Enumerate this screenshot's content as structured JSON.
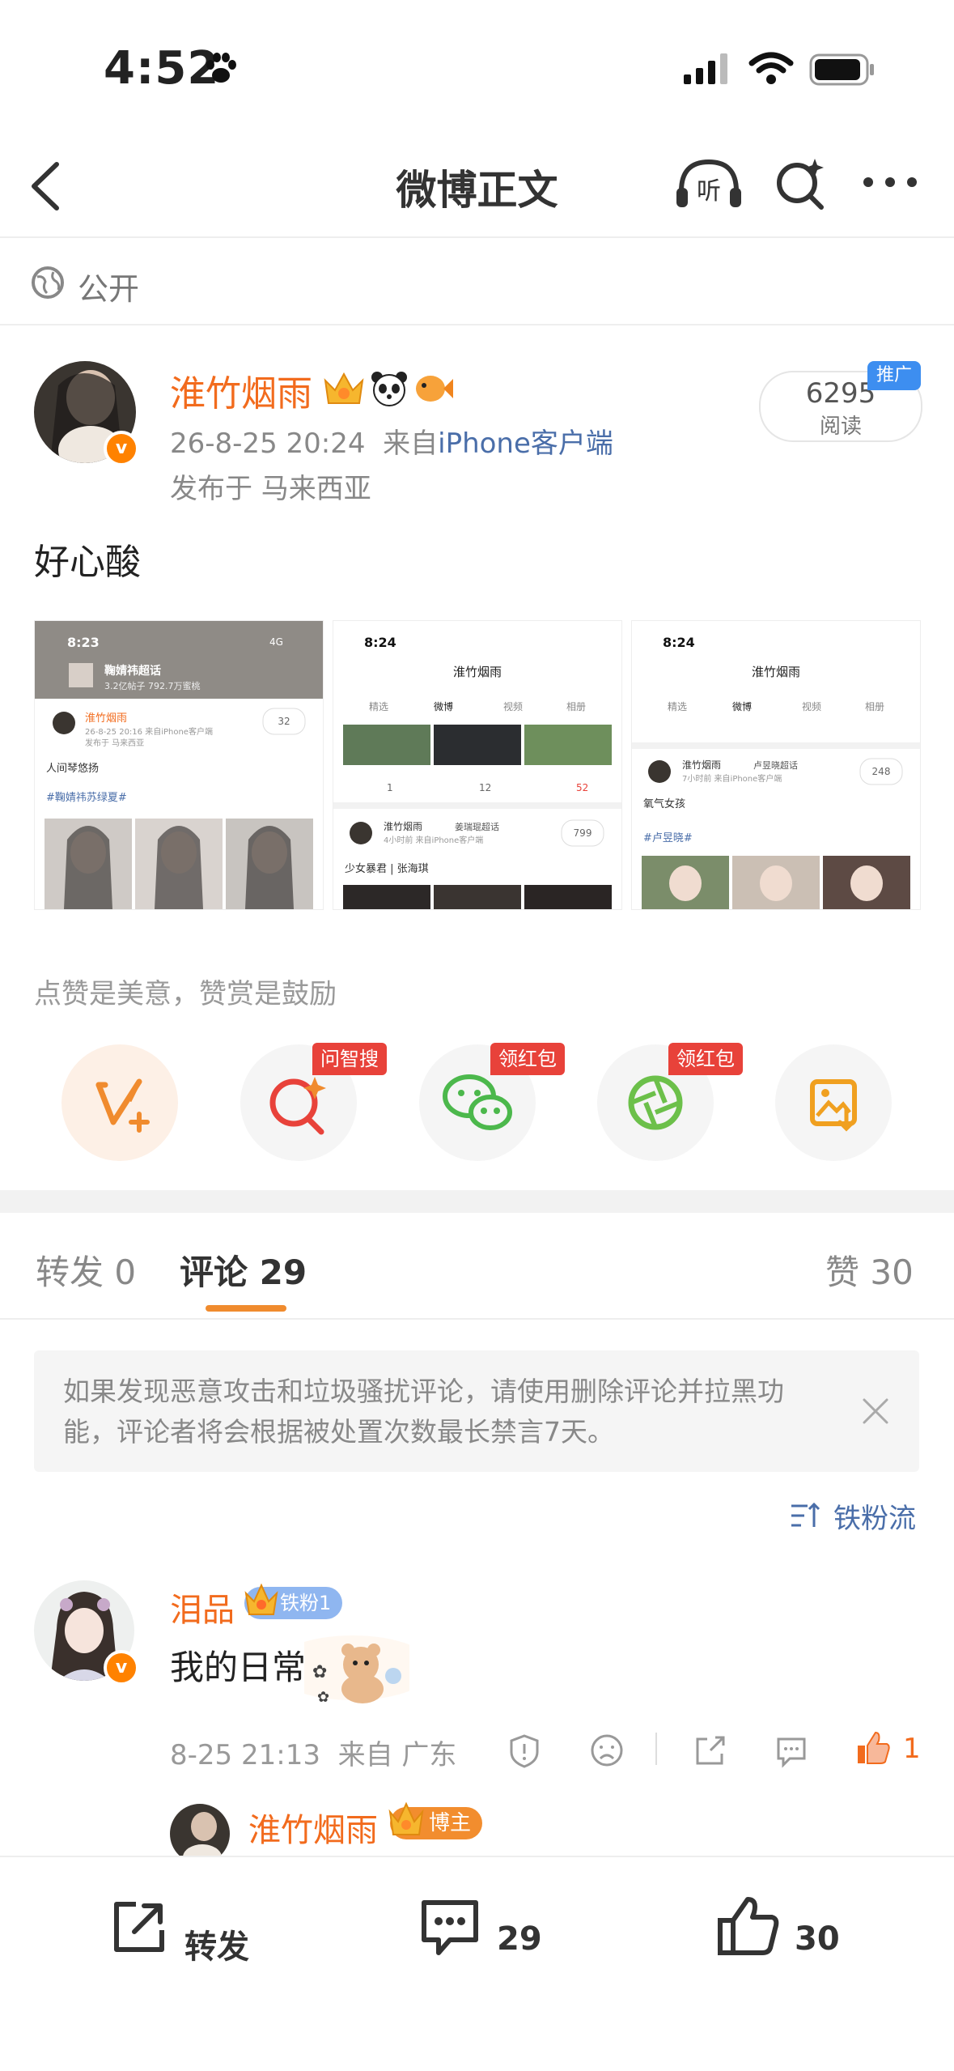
{
  "status_bar": {
    "time": "4:52"
  },
  "nav": {
    "title": "微博正文"
  },
  "visibility": {
    "label": "公开"
  },
  "post": {
    "author": "淮竹烟雨",
    "timestamp": "26-8-25 20:24",
    "source_prefix": "来自",
    "source": "iPhone客户端",
    "location": "发布于 马来西亚",
    "reads": "6295",
    "reads_label": "阅读",
    "promo_label": "推广",
    "text": "好心酸"
  },
  "thumbnails": [
    {
      "time": "8:23",
      "title": "鞠婧祎超话",
      "sub": "3.2亿帖子 792.7万蜜桃",
      "name": "淮竹烟雨",
      "date": "26-8-25 20:16 来自iPhone客户端",
      "loc": "发布于 马来西亚",
      "line1": "人间琴悠扬",
      "tag": "#鞠婧祎苏绿夏#",
      "count": "32"
    },
    {
      "time": "8:24",
      "title": "淮竹烟雨",
      "tabs": [
        "精选",
        "微博",
        "视频",
        "相册"
      ],
      "reposts": "1",
      "comments": "12",
      "likes": "52",
      "name": "淮竹烟雨",
      "topic": "姜瑞琨超话",
      "date": "4小时前 来自iPhone客户端",
      "count": "799",
      "line1": "少女暴君 | 张海琪"
    },
    {
      "time": "8:24",
      "title": "淮竹烟雨",
      "tabs": [
        "精选",
        "微博",
        "视频",
        "相册"
      ],
      "name": "淮竹烟雨",
      "topic": "卢昱晓超话",
      "date": "7小时前 来自iPhone客户端",
      "count": "248",
      "line1": "氧气女孩",
      "tag": "#卢昱晓#"
    }
  ],
  "encourage": "点赞是美意，赞赏是鼓励",
  "rewards": [
    {
      "name": "reward-v-plus",
      "tag": ""
    },
    {
      "name": "ask-search",
      "tag": "问智搜"
    },
    {
      "name": "wechat-redpack",
      "tag": "领红包"
    },
    {
      "name": "camera-redpack",
      "tag": "领红包"
    },
    {
      "name": "save-image",
      "tag": ""
    }
  ],
  "tabs": {
    "repost": "转发 0",
    "comment": "评论 29",
    "like": "赞 30"
  },
  "notice": "如果发现恶意攻击和垃圾骚扰评论，请使用删除评论并拉黑功能，评论者将会根据被处置次数最长禁言7天。",
  "sort_label": "铁粉流",
  "comment": {
    "author": "泪品",
    "fan_badge": "铁粉1",
    "text": "我的日常",
    "time": "8-25 21:13",
    "source_prefix": "来自",
    "source": "广东",
    "likes": "1"
  },
  "reply": {
    "author": "淮竹烟雨",
    "badge": "博主"
  },
  "bottom_bar": {
    "repost_label": "转发",
    "comment_count": "29",
    "like_count": "30"
  },
  "colors": {
    "accent": "#f26b1d",
    "link": "#4a6ea9",
    "tab_underline": "#f08b2e",
    "tag_red": "#e8423a",
    "promo_blue": "#3d8ef0"
  }
}
